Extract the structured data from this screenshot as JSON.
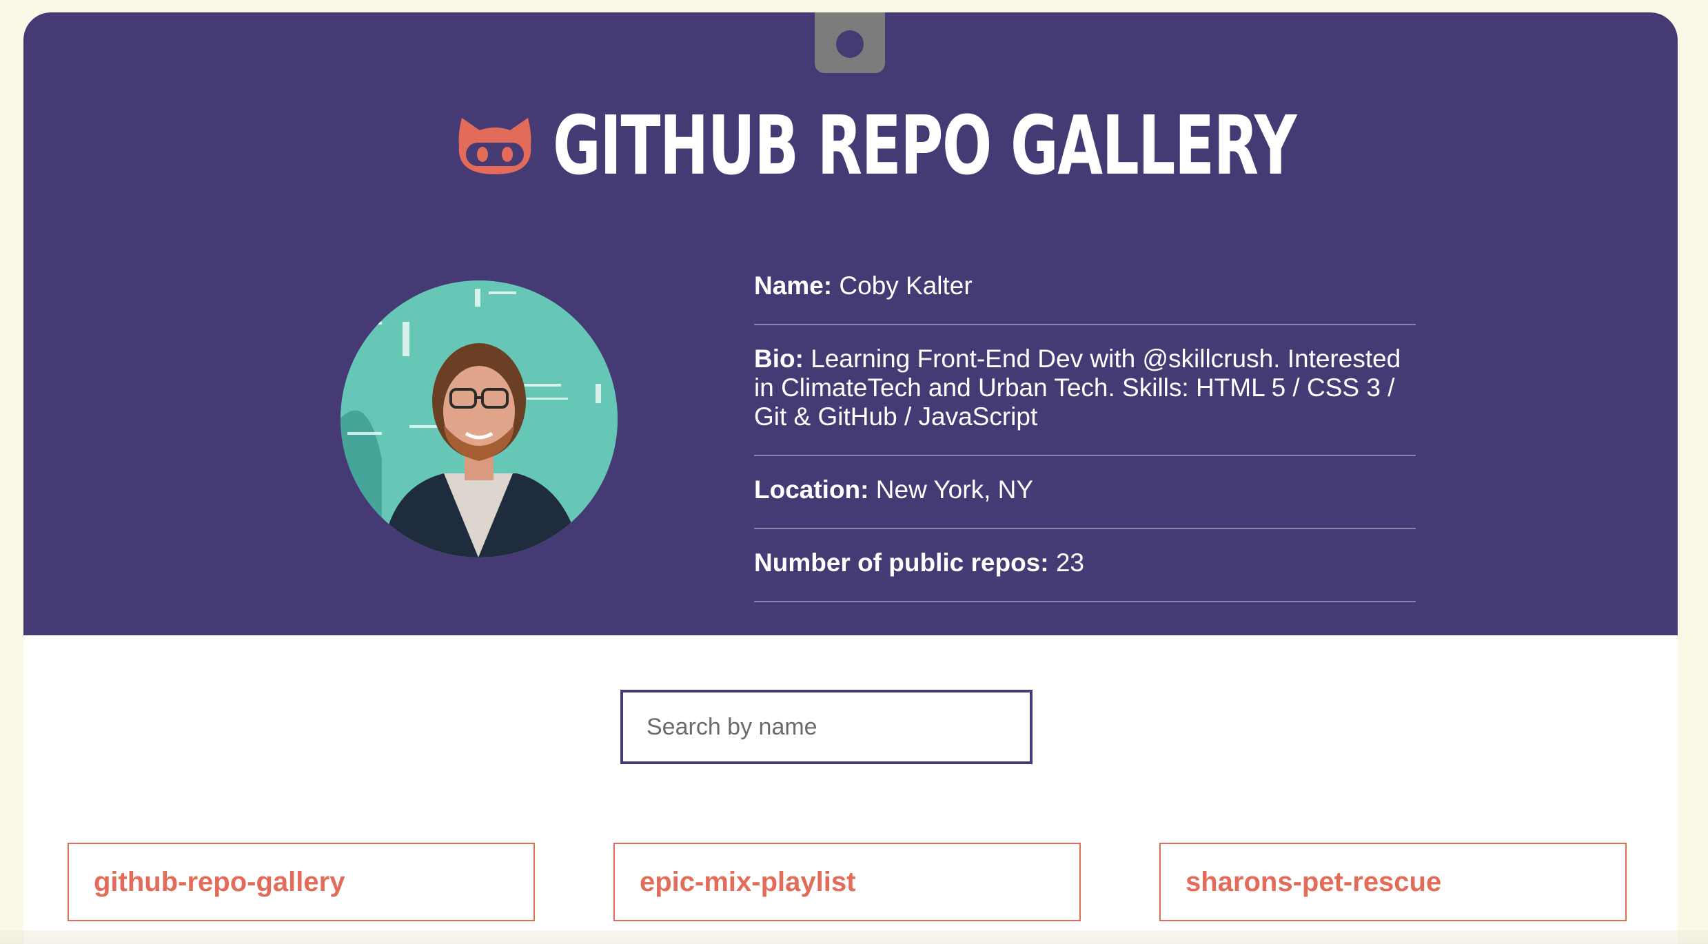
{
  "header": {
    "title": "GITHUB REPO GALLERY",
    "logo_icon": "octocat-icon"
  },
  "profile": {
    "avatar_alt": "Coby Kalter",
    "name_label": "Name:",
    "name_value": "Coby Kalter",
    "bio_label": "Bio:",
    "bio_value": "Learning Front-End Dev with @skillcrush. Interested in ClimateTech and Urban Tech. Skills: HTML 5 / CSS 3 / Git & GitHub / JavaScript",
    "location_label": "Location:",
    "location_value": "New York, NY",
    "repos_label": "Number of public repos:",
    "repos_value": "23"
  },
  "search": {
    "placeholder": "Search by name",
    "value": ""
  },
  "repos": [
    {
      "name": "github-repo-gallery"
    },
    {
      "name": "epic-mix-playlist"
    },
    {
      "name": "sharons-pet-rescue"
    }
  ],
  "colors": {
    "page_background": "#fbf8e7",
    "hero_background": "#463a74",
    "accent": "#e26c59",
    "binder_tab": "#7c7c7c"
  }
}
